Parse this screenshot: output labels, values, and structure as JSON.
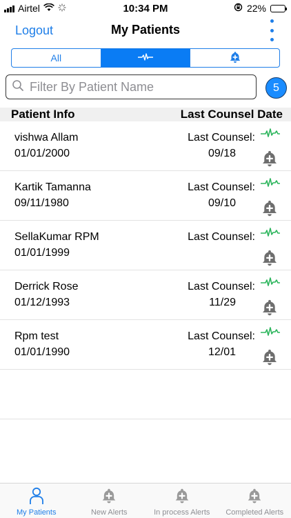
{
  "status_bar": {
    "carrier": "Airtel",
    "time": "10:34 PM",
    "battery_percent": "22%",
    "battery_level": 0.22
  },
  "nav": {
    "logout_label": "Logout",
    "title": "My Patients",
    "menu_icon": "more-vertical-icon"
  },
  "segments": [
    {
      "label": "All",
      "icon": null,
      "active": false
    },
    {
      "label": "",
      "icon": "pulse-icon",
      "active": true
    },
    {
      "label": "",
      "icon": "bell-plus-icon",
      "active": false
    }
  ],
  "search": {
    "placeholder": "Filter By Patient Name",
    "value": "",
    "count": "5"
  },
  "columns": {
    "patient_info": "Patient Info",
    "last_counsel_date": "Last Counsel Date"
  },
  "patients": [
    {
      "name": "vishwa Allam",
      "dob": "01/01/2000",
      "last_counsel_label": "Last Counsel:",
      "last_counsel_date": "09/18"
    },
    {
      "name": "Kartik Tamanna",
      "dob": "09/11/1980",
      "last_counsel_label": "Last Counsel:",
      "last_counsel_date": "09/10"
    },
    {
      "name": "SellaKumar RPM",
      "dob": "01/01/1999",
      "last_counsel_label": "Last Counsel:",
      "last_counsel_date": ""
    },
    {
      "name": "Derrick Rose",
      "dob": "01/12/1993",
      "last_counsel_label": "Last Counsel:",
      "last_counsel_date": "11/29"
    },
    {
      "name": "Rpm test",
      "dob": "01/01/1990",
      "last_counsel_label": "Last Counsel:",
      "last_counsel_date": "12/01"
    }
  ],
  "tabs": [
    {
      "label": "My Patients",
      "icon": "person-icon",
      "active": true
    },
    {
      "label": "New Alerts",
      "icon": "bell-plus-icon",
      "active": false
    },
    {
      "label": "In process Alerts",
      "icon": "bell-plus-icon",
      "active": false
    },
    {
      "label": "Completed Alerts",
      "icon": "bell-plus-icon",
      "active": false
    }
  ],
  "colors": {
    "accent": "#1e7ee8",
    "pulse": "#2db55d",
    "bell": "#6e6e6e",
    "header_bg": "#f0f0f0"
  }
}
